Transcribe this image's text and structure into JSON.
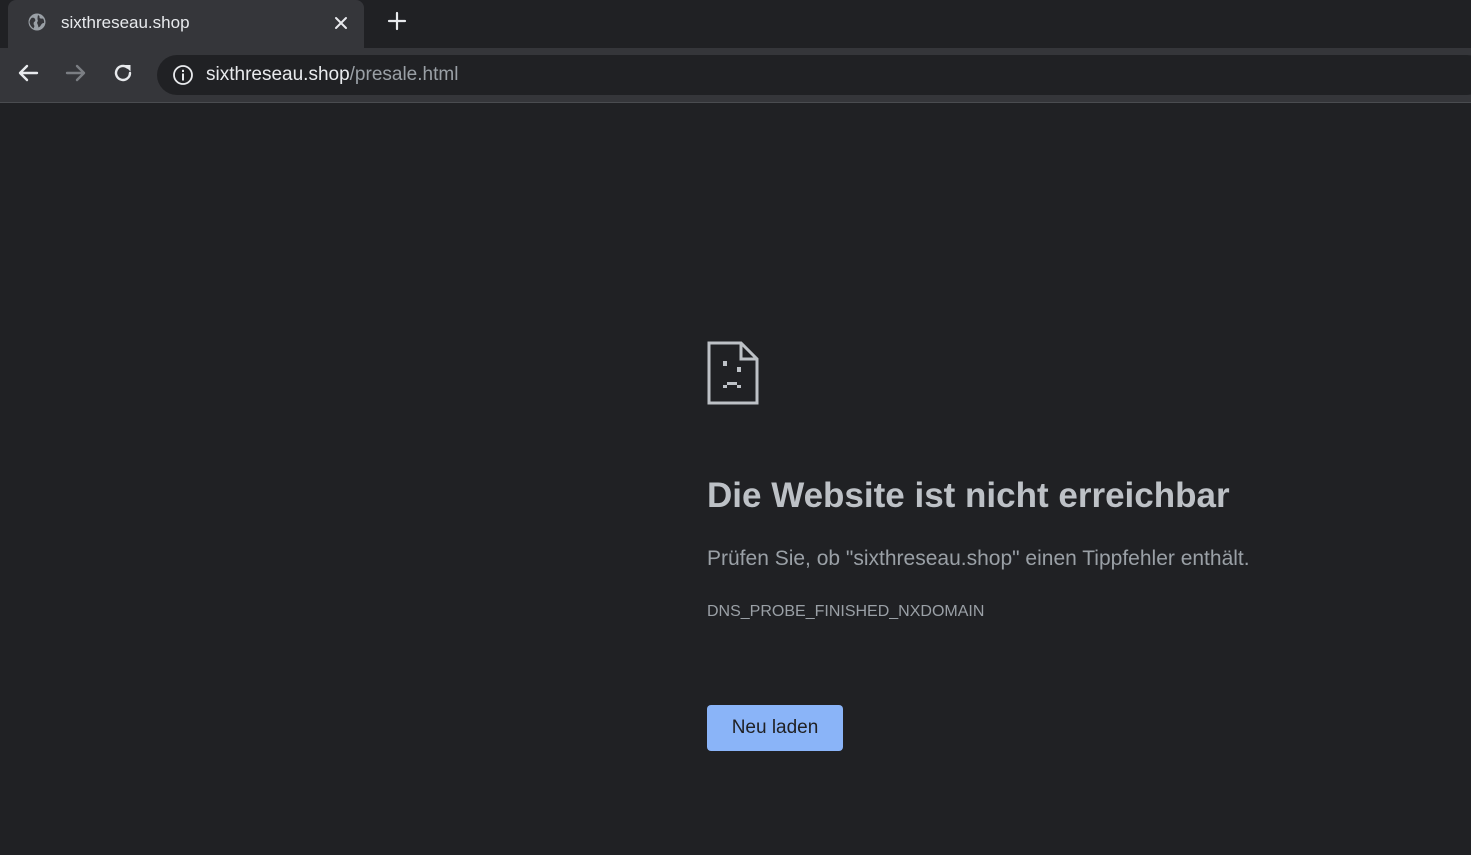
{
  "tab": {
    "title": "sixthreseau.shop",
    "favicon_icon": "globe-icon",
    "close_icon": "close-icon"
  },
  "new_tab_icon": "plus-icon",
  "toolbar": {
    "back_icon": "arrow-left-icon",
    "forward_icon": "arrow-right-icon",
    "reload_icon": "reload-icon",
    "site_info_icon": "info-icon",
    "url_host": "sixthreseau.shop",
    "url_path": "/presale.html"
  },
  "error": {
    "icon": "sad-page-icon",
    "heading": "Die Website ist nicht erreichbar",
    "message": "Prüfen Sie, ob \"sixthreseau.shop\" einen Tippfehler enthält.",
    "code": "DNS_PROBE_FINISHED_NXDOMAIN",
    "reload_label": "Neu laden"
  },
  "colors": {
    "background": "#202124",
    "toolbar": "#35363a",
    "heading": "#bdc1c6",
    "secondary_text": "#9aa0a6",
    "button": "#8ab4f8"
  }
}
